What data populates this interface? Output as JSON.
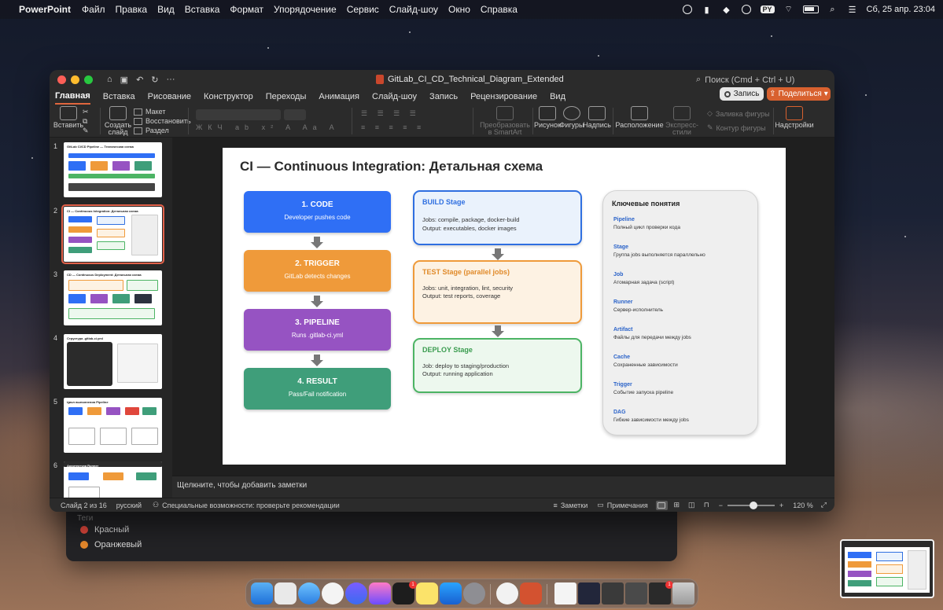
{
  "menubar": {
    "app_name": "PowerPoint",
    "menus": [
      "Файл",
      "Правка",
      "Вид",
      "Вставка",
      "Формат",
      "Упорядочение",
      "Сервис",
      "Слайд-шоу",
      "Окно",
      "Справка"
    ],
    "input_badge": "PY",
    "datetime": "Сб, 25 апр.  23:04"
  },
  "window": {
    "doc_title": "GitLab_CI_CD_Technical_Diagram_Extended",
    "search_placeholder": "Поиск (Cmd + Ctrl + U)",
    "record_label": "Запись",
    "share_label": "Поделиться"
  },
  "ribbon_tabs": [
    "Главная",
    "Вставка",
    "Рисование",
    "Конструктор",
    "Переходы",
    "Анимация",
    "Слайд-шоу",
    "Запись",
    "Рецензирование",
    "Вид"
  ],
  "ribbon": {
    "paste": "Вставить",
    "new_slide": "Создать\nслайд",
    "layout": "Макет",
    "reset": "Восстановить",
    "section": "Раздел",
    "smartart": "Преобразовать\nв SmartArt",
    "picture": "Рисунок",
    "shapes": "Фигуры",
    "textbox": "Надпись",
    "arrange": "Расположение",
    "express_styles": "Экспресс-стили",
    "shape_fill": "Заливка фигуры",
    "shape_outline": "Контур фигуры",
    "addins": "Надстройки"
  },
  "thumbnails": [
    {
      "num": "1",
      "title": "GitLab CI/CD Pipeline — Техническая схема"
    },
    {
      "num": "2",
      "title": "CI — Continuous Integration: Детальная схема"
    },
    {
      "num": "3",
      "title": "CD — Continuous Deployment: Детальная схема"
    },
    {
      "num": "4",
      "title": "Структура .gitlab-ci.yml"
    },
    {
      "num": "5",
      "title": "Цикл выполнения Pipeline"
    },
    {
      "num": "6",
      "title": "Архитектура Runner"
    }
  ],
  "slide": {
    "title": "CI — Continuous Integration: Детальная схема",
    "steps": [
      {
        "title": "1. CODE",
        "subtitle": "Developer pushes code",
        "color": "#2f6ff5"
      },
      {
        "title": "2. TRIGGER",
        "subtitle": "GitLab detects changes",
        "color": "#ef9a3a"
      },
      {
        "title": "3. PIPELINE",
        "subtitle": "Runs .gitlab-ci.yml",
        "color": "#9653c2"
      },
      {
        "title": "4. RESULT",
        "subtitle": "Pass/Fail notification",
        "color": "#3f9e7a"
      }
    ],
    "stages": [
      {
        "title": "BUILD Stage",
        "line1": "Jobs: compile, package, docker-build",
        "line2": "Output: executables, docker images",
        "border": "#2f6fe0",
        "bg": "#eaf2fc",
        "title_color": "#2f6fe0"
      },
      {
        "title": "TEST Stage (parallel jobs)",
        "line1": "Jobs: unit, integration, lint, security",
        "line2": "Output: test reports, coverage",
        "border": "#ef9a3a",
        "bg": "#fdf2e3",
        "title_color": "#e08a2a"
      },
      {
        "title": "DEPLOY Stage",
        "line1": "Job: deploy to staging/production",
        "line2": "Output: running application",
        "border": "#4cb464",
        "bg": "#edf8ee",
        "title_color": "#3a9c4f"
      }
    ],
    "concepts_heading": "Ключевые понятия",
    "concepts": [
      {
        "term": "Pipeline",
        "desc": "Полный цикл проверки кода"
      },
      {
        "term": "Stage",
        "desc": "Группа jobs выполняется параллельно"
      },
      {
        "term": "Job",
        "desc": "Атомарная задача (script)"
      },
      {
        "term": "Runner",
        "desc": "Сервер-исполнитель"
      },
      {
        "term": "Artifact",
        "desc": "Файлы для передачи между jobs"
      },
      {
        "term": "Cache",
        "desc": "Сохраненные зависимости"
      },
      {
        "term": "Trigger",
        "desc": "Событие запуска pipeline"
      },
      {
        "term": "DAG",
        "desc": "Гибкие зависимости между jobs"
      }
    ]
  },
  "notes_placeholder": "Щелкните, чтобы добавить заметки",
  "status": {
    "slide_counter": "Слайд 2 из 16",
    "language": "русский",
    "accessibility": "Специальные возможности: проверьте рекомендации",
    "notes": "Заметки",
    "comments": "Примечания",
    "zoom": "120 %"
  },
  "background_window": {
    "header": "Теги",
    "tags": [
      {
        "label": "Красный",
        "color": "#e0473c"
      },
      {
        "label": "Оранжевый",
        "color": "#e98a2c"
      }
    ]
  }
}
